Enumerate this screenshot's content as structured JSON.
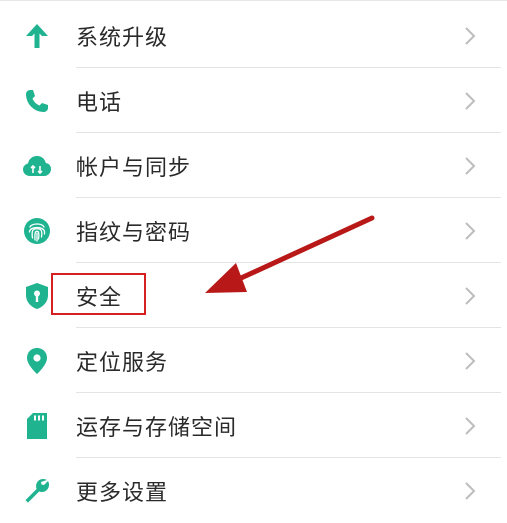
{
  "settings": {
    "items": [
      {
        "label": "系统升级",
        "icon": "arrow-up-icon"
      },
      {
        "label": "电话",
        "icon": "phone-icon"
      },
      {
        "label": "帐户与同步",
        "icon": "cloud-sync-icon"
      },
      {
        "label": "指纹与密码",
        "icon": "fingerprint-icon"
      },
      {
        "label": "安全",
        "icon": "shield-icon"
      },
      {
        "label": "定位服务",
        "icon": "location-pin-icon"
      },
      {
        "label": "运存与存储空间",
        "icon": "sd-card-icon"
      },
      {
        "label": "更多设置",
        "icon": "wrench-icon"
      }
    ]
  },
  "colors": {
    "accent": "#1fb38f",
    "text": "#2a2a2a",
    "chevron": "#bdbdbd",
    "divider": "#e4e4e4",
    "annotation": "#d42020"
  },
  "annotation": {
    "highlighted_item": "安全",
    "arrow_color": "#b81818"
  }
}
